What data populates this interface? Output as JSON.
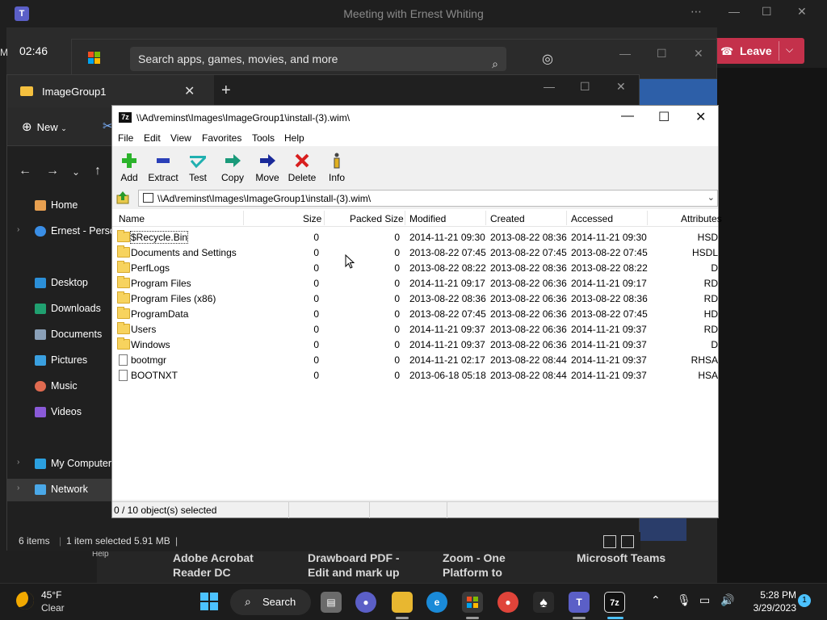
{
  "teams": {
    "title": "Meeting with Ernest Whiting",
    "clock": "02:46",
    "side_letter": "M",
    "leave_label": "Leave",
    "help": "Help",
    "tiles": [
      {
        "line1": "Adobe Acrobat",
        "line2": "Reader DC"
      },
      {
        "line1": "Drawboard PDF -",
        "line2": "Edit and mark up"
      },
      {
        "line1": "Zoom - One",
        "line2": "Platform to"
      },
      {
        "line1": "Microsoft Teams",
        "line2": ""
      }
    ],
    "accent": "#c4314b"
  },
  "store": {
    "search_placeholder": "Search apps, games, movies, and more"
  },
  "explorer": {
    "tab_title": "ImageGroup1",
    "new_label": "New",
    "sidebar": [
      {
        "label": "Home",
        "icon": "home-icon"
      },
      {
        "label": "Ernest - Personal",
        "icon": "onedrive-icon"
      },
      {
        "label": "Desktop",
        "icon": "desktop-icon"
      },
      {
        "label": "Downloads",
        "icon": "download-icon"
      },
      {
        "label": "Documents",
        "icon": "documents-icon"
      },
      {
        "label": "Pictures",
        "icon": "pictures-icon"
      },
      {
        "label": "Music",
        "icon": "music-icon"
      },
      {
        "label": "Videos",
        "icon": "videos-icon"
      },
      {
        "label": "My Computer",
        "icon": "computer-icon"
      },
      {
        "label": "Network",
        "icon": "network-icon"
      }
    ],
    "status": {
      "items": "6 items",
      "selected": "1 item selected  5.91 MB"
    }
  },
  "sevenzip": {
    "title": "\\\\Ad\\reminst\\Images\\ImageGroup1\\install-(3).wim\\",
    "menu": [
      "File",
      "Edit",
      "View",
      "Favorites",
      "Tools",
      "Help"
    ],
    "toolbar": [
      {
        "label": "Add",
        "icon": "add-icon"
      },
      {
        "label": "Extract",
        "icon": "extract-icon"
      },
      {
        "label": "Test",
        "icon": "test-icon"
      },
      {
        "label": "Copy",
        "icon": "copy-icon"
      },
      {
        "label": "Move",
        "icon": "move-icon"
      },
      {
        "label": "Delete",
        "icon": "delete-icon"
      },
      {
        "label": "Info",
        "icon": "info-icon"
      }
    ],
    "address": "\\\\Ad\\reminst\\Images\\ImageGroup1\\install-(3).wim\\",
    "columns": [
      "Name",
      "Size",
      "Packed Size",
      "Modified",
      "Created",
      "Accessed",
      "Attributes"
    ],
    "rows": [
      {
        "name": "$Recycle.Bin",
        "type": "folder",
        "size": "0",
        "packed": "0",
        "modified": "2014-11-21 09:30",
        "created": "2013-08-22 08:36",
        "accessed": "2014-11-21 09:30",
        "attr": "HSD"
      },
      {
        "name": "Documents and Settings",
        "type": "folder",
        "size": "0",
        "packed": "0",
        "modified": "2013-08-22 07:45",
        "created": "2013-08-22 07:45",
        "accessed": "2013-08-22 07:45",
        "attr": "HSDL"
      },
      {
        "name": "PerfLogs",
        "type": "folder",
        "size": "0",
        "packed": "0",
        "modified": "2013-08-22 08:22",
        "created": "2013-08-22 08:36",
        "accessed": "2013-08-22 08:22",
        "attr": "D"
      },
      {
        "name": "Program Files",
        "type": "folder",
        "size": "0",
        "packed": "0",
        "modified": "2014-11-21 09:17",
        "created": "2013-08-22 06:36",
        "accessed": "2014-11-21 09:17",
        "attr": "RD"
      },
      {
        "name": "Program Files (x86)",
        "type": "folder",
        "size": "0",
        "packed": "0",
        "modified": "2013-08-22 08:36",
        "created": "2013-08-22 06:36",
        "accessed": "2013-08-22 08:36",
        "attr": "RD"
      },
      {
        "name": "ProgramData",
        "type": "folder",
        "size": "0",
        "packed": "0",
        "modified": "2013-08-22 07:45",
        "created": "2013-08-22 06:36",
        "accessed": "2013-08-22 07:45",
        "attr": "HD"
      },
      {
        "name": "Users",
        "type": "folder",
        "size": "0",
        "packed": "0",
        "modified": "2014-11-21 09:37",
        "created": "2013-08-22 06:36",
        "accessed": "2014-11-21 09:37",
        "attr": "RD"
      },
      {
        "name": "Windows",
        "type": "folder",
        "size": "0",
        "packed": "0",
        "modified": "2014-11-21 09:37",
        "created": "2013-08-22 06:36",
        "accessed": "2014-11-21 09:37",
        "attr": "D"
      },
      {
        "name": "bootmgr",
        "type": "file",
        "size": "0",
        "packed": "0",
        "modified": "2014-11-21 02:17",
        "created": "2013-08-22 08:44",
        "accessed": "2014-11-21 09:37",
        "attr": "RHSA"
      },
      {
        "name": "BOOTNXT",
        "type": "file",
        "size": "0",
        "packed": "0",
        "modified": "2013-06-18 05:18",
        "created": "2013-08-22 08:44",
        "accessed": "2014-11-21 09:37",
        "attr": "HSA"
      }
    ],
    "status": "0 / 10 object(s) selected"
  },
  "taskbar": {
    "temp": "45°F",
    "condition": "Clear",
    "search_label": "Search",
    "time": "5:28 PM",
    "date": "3/29/2023",
    "notification_count": "1",
    "teams_letter": "T",
    "sevenzip_letters": "7z"
  }
}
